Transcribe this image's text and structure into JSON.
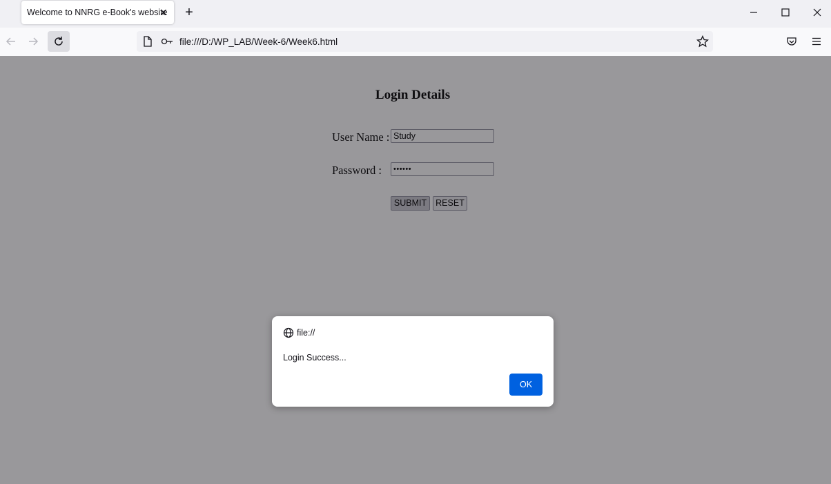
{
  "browser": {
    "tab_title": "Welcome to NNRG e-Book's website",
    "tab_close": "✕",
    "new_tab": "+",
    "url": "file:///D:/WP_LAB/Week-6/Week6.html"
  },
  "page": {
    "heading": "Login Details",
    "username_label": "User Name :",
    "username_value": "Study",
    "password_label": "Password :",
    "password_value": "••••••",
    "submit_label": "SUBMIT",
    "reset_label": "RESET"
  },
  "dialog": {
    "origin": "file://",
    "message": "Login Success...",
    "ok_label": "OK"
  },
  "colors": {
    "dialog_button": "#0061e0",
    "overlay": "#999999"
  }
}
